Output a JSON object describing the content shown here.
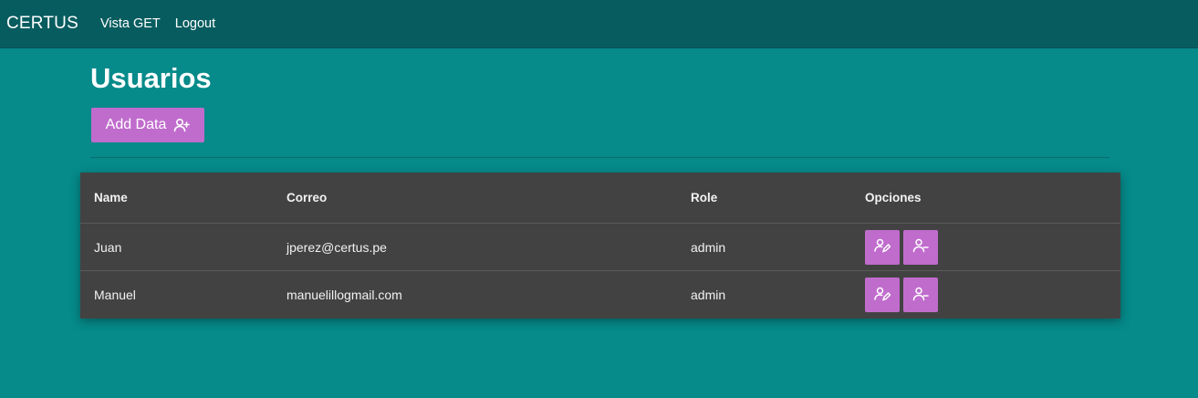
{
  "navbar": {
    "brand": "CERTUS",
    "links": [
      "Vista GET",
      "Logout"
    ]
  },
  "page": {
    "title": "Usuarios",
    "add_button_label": "Add Data",
    "add_button_icon": "user-plus-icon"
  },
  "table": {
    "columns": [
      "Name",
      "Correo",
      "Role",
      "Opciones"
    ],
    "rows": [
      {
        "name": "Juan",
        "email": "jperez@certus.pe",
        "role": "admin"
      },
      {
        "name": "Manuel",
        "email": "manuelillogmail.com",
        "role": "admin"
      }
    ],
    "row_actions": [
      "user-edit-icon",
      "user-minus-icon"
    ]
  },
  "colors": {
    "background": "#068a8a",
    "navbar": "#075c5f",
    "accent": "#c06ccd",
    "table": "#434242"
  }
}
